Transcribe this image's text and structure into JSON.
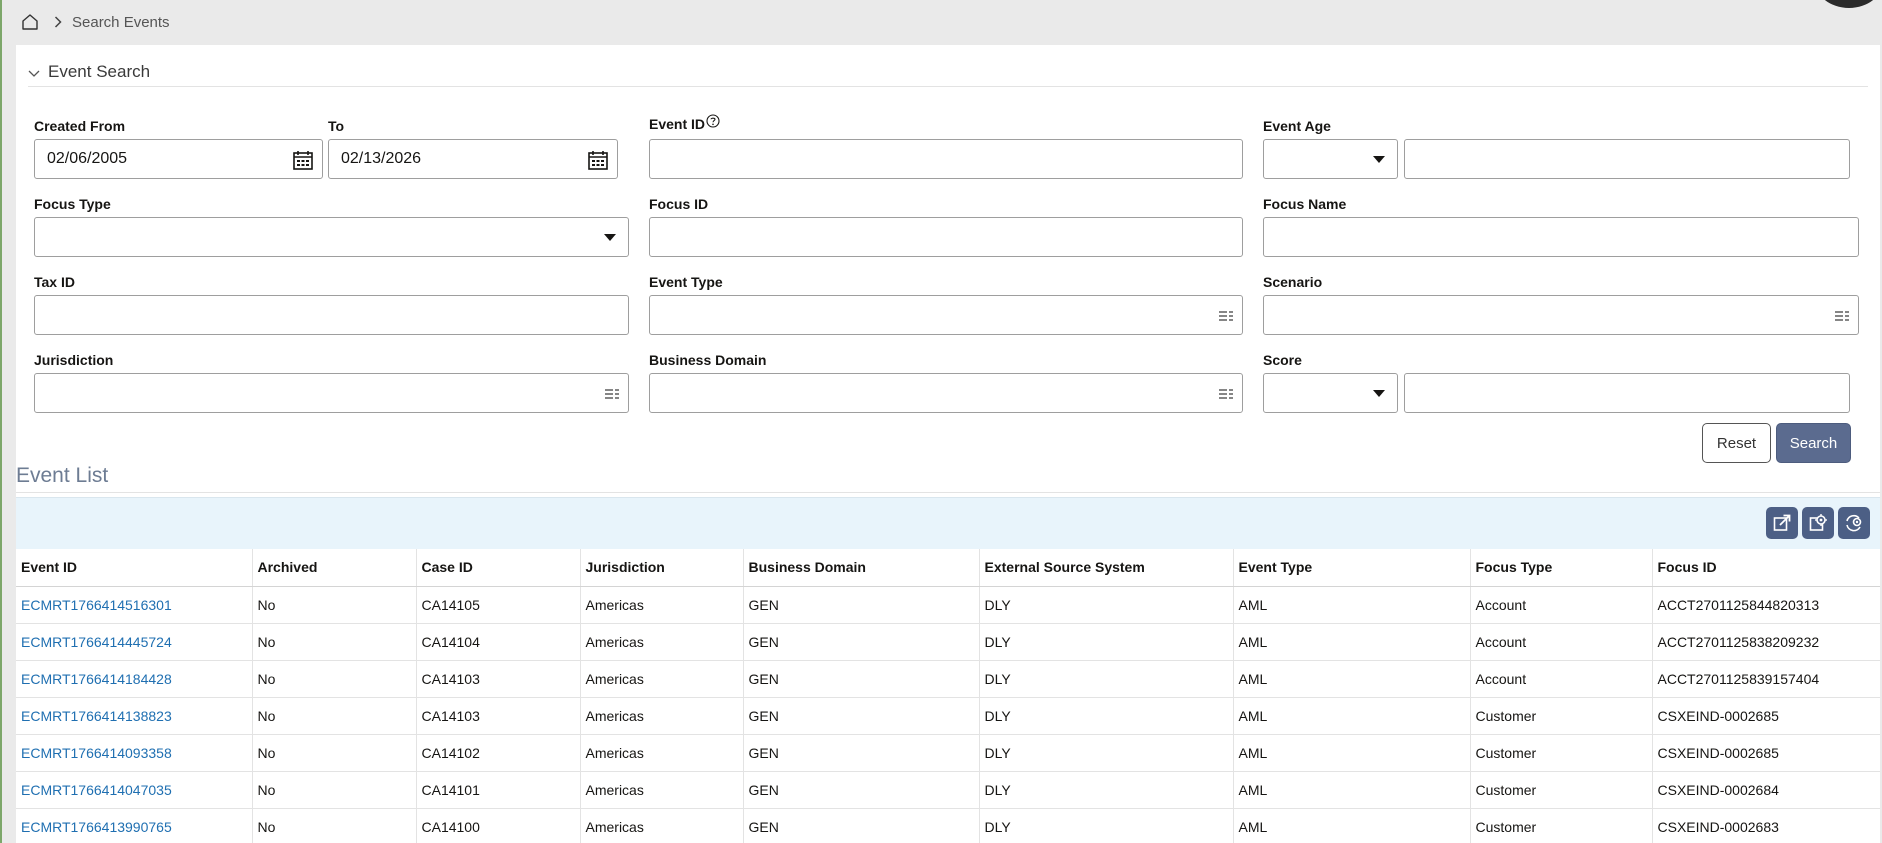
{
  "breadcrumb": {
    "home_icon": "home-icon",
    "current": "Search Events"
  },
  "search": {
    "title": "Event Search",
    "labels": {
      "created_from": "Created From",
      "to": "To",
      "event_id": "Event ID",
      "event_age": "Event Age",
      "focus_type": "Focus Type",
      "focus_id": "Focus ID",
      "focus_name": "Focus Name",
      "tax_id": "Tax ID",
      "event_type": "Event Type",
      "scenario": "Scenario",
      "jurisdiction": "Jurisdiction",
      "business_domain": "Business Domain",
      "score": "Score"
    },
    "values": {
      "created_from": "02/06/2005",
      "to": "02/13/2026",
      "event_id": "",
      "event_age_op": "",
      "event_age": "",
      "focus_type": "",
      "focus_id": "",
      "focus_name": "",
      "tax_id": "",
      "event_type": "",
      "scenario": "",
      "jurisdiction": "",
      "business_domain": "",
      "score_op": "",
      "score": ""
    },
    "buttons": {
      "reset": "Reset",
      "search": "Search"
    }
  },
  "list": {
    "title": "Event List",
    "toolbar_icons": [
      "export-icon",
      "settings-icon",
      "refresh-settings-icon"
    ],
    "columns": [
      "Event ID",
      "Archived",
      "Case ID",
      "Jurisdiction",
      "Business Domain",
      "External Source System",
      "Event Type",
      "Focus Type",
      "Focus ID"
    ],
    "rows": [
      [
        "ECMRT1766414516301",
        "No",
        "CA14105",
        "Americas",
        "GEN",
        "DLY",
        "AML",
        "Account",
        "ACCT2701125844820313"
      ],
      [
        "ECMRT1766414445724",
        "No",
        "CA14104",
        "Americas",
        "GEN",
        "DLY",
        "AML",
        "Account",
        "ACCT2701125838209232"
      ],
      [
        "ECMRT1766414184428",
        "No",
        "CA14103",
        "Americas",
        "GEN",
        "DLY",
        "AML",
        "Account",
        "ACCT2701125839157404"
      ],
      [
        "ECMRT1766414138823",
        "No",
        "CA14103",
        "Americas",
        "GEN",
        "DLY",
        "AML",
        "Customer",
        "CSXEIND-0002685"
      ],
      [
        "ECMRT1766414093358",
        "No",
        "CA14102",
        "Americas",
        "GEN",
        "DLY",
        "AML",
        "Customer",
        "CSXEIND-0002685"
      ],
      [
        "ECMRT1766414047035",
        "No",
        "CA14101",
        "Americas",
        "GEN",
        "DLY",
        "AML",
        "Customer",
        "CSXEIND-0002684"
      ],
      [
        "ECMRT1766413990765",
        "No",
        "CA14100",
        "Americas",
        "GEN",
        "DLY",
        "AML",
        "Customer",
        "CSXEIND-0002683"
      ]
    ]
  },
  "colors": {
    "link": "#1f6fb1",
    "primary_button": "#5b6b8f",
    "toolbar_bg": "#e8f4fb",
    "tool_button": "#4c5f85"
  }
}
